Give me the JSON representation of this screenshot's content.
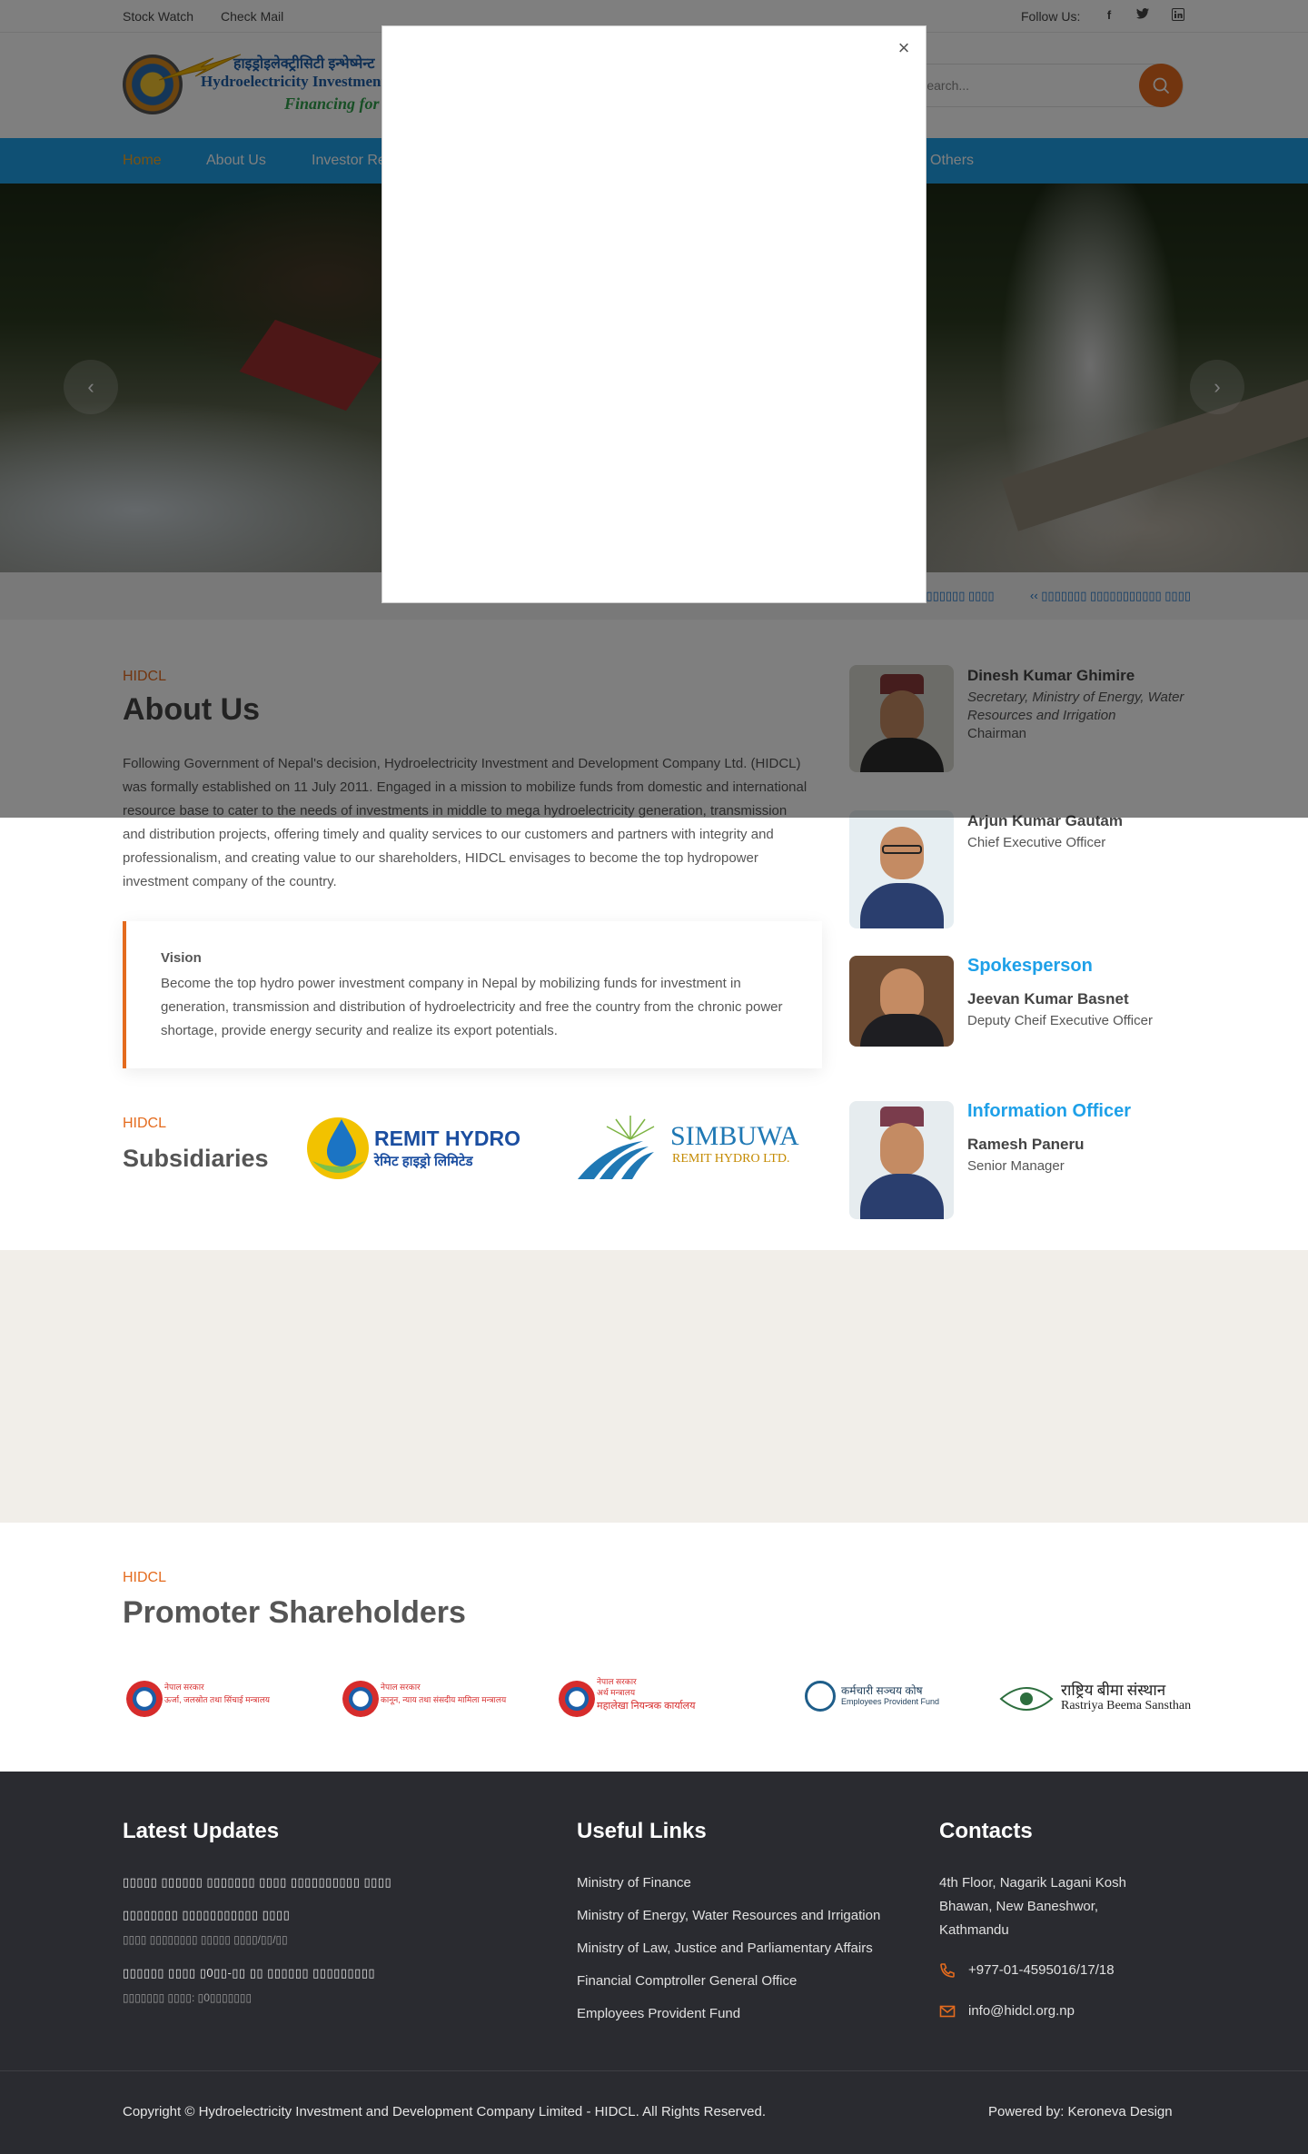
{
  "topbar": {
    "links": [
      "Stock Watch",
      "Check Mail"
    ],
    "follow_label": "Follow Us:",
    "social_icons": [
      "facebook-icon",
      "twitter-icon",
      "linkedin-icon"
    ]
  },
  "header": {
    "logo_line1": "हाइड्रोइलेक्ट्रीसिटी इन्भेष्मेन्ट",
    "logo_line2": "Hydroelectricity Investment",
    "logo_line3": "Financing for",
    "search_placeholder": "Search..."
  },
  "nav": {
    "items": [
      "Home",
      "About Us",
      "Investor Re",
      "Others"
    ],
    "active": "Home"
  },
  "ticker": {
    "items": [
      "‹‹ ▯▯▯▯▯▯▯ ▯▯▯▯",
      "‹‹ ▯▯▯▯▯▯▯ ▯▯▯▯▯▯▯▯▯▯▯ ▯▯▯▯"
    ]
  },
  "about": {
    "eyebrow": "HIDCL",
    "title": "About Us",
    "body": "Following Government of Nepal's decision, Hydroelectricity Investment and Development Company Ltd. (HIDCL) was formally established on 11 July 2011. Engaged in a mission to mobilize funds from domestic and international resource base to cater to the needs of investments in middle to mega hydroelectricity generation, transmission and distribution projects, offering timely and quality services to our customers and partners with integrity and professionalism, and creating value to our shareholders, HIDCL envisages to become the top hydropower investment company of the country.",
    "vision_title": "Vision",
    "vision_body": "Become the top hydro power investment company in Nepal by mobilizing funds for investment in generation, transmission and distribution of hydroelectricity and free the country from the chronic power shortage, provide energy security and realize its export potentials."
  },
  "subsidiaries": {
    "eyebrow": "HIDCL",
    "title": "Subsidiaries",
    "logos": [
      {
        "name": "REMIT HYDRO",
        "sub": "रेमिट हाइड्रो लिमिटेड"
      },
      {
        "name": "SIMBUWA",
        "sub": "REMIT HYDRO LTD."
      }
    ]
  },
  "people": [
    {
      "name": "Dinesh Kumar Ghimire",
      "role": "Secretary, Ministry of Energy, Water Resources and Irrigation",
      "title": "Chairman"
    },
    {
      "name": "Arjun Kumar Gautam",
      "role": "Chief Executive Officer"
    },
    {
      "heading": "Spokesperson",
      "name": "Jeevan Kumar Basnet",
      "role": "Deputy Cheif Executive Officer"
    },
    {
      "heading": "Information Officer",
      "name": "Ramesh Paneru",
      "role": "Senior Manager"
    }
  ],
  "modal": {
    "close_label": "×"
  },
  "promoters": {
    "eyebrow": "HIDCL",
    "title": "Promoter Shareholders",
    "logos": [
      {
        "t1": "नेपाल सरकार",
        "t2": "ऊर्जा, जलस्रोत तथा सिंचाई मन्त्रालय"
      },
      {
        "t1": "नेपाल सरकार",
        "t2": "कानून, न्याय तथा संसदीय मामिला मन्त्रालय"
      },
      {
        "t1": "नेपाल सरकार",
        "t2": "अर्थ मन्त्रालय",
        "t3": "महालेखा नियन्त्रक कार्यालय"
      },
      {
        "t1": "कर्मचारी सञ्चय कोष",
        "t2": "Employees Provident Fund"
      },
      {
        "t1": "राष्ट्रिय बीमा संस्थान",
        "t2": "Rastriya Beema Sansthan"
      }
    ]
  },
  "footer": {
    "updates_title": "Latest Updates",
    "updates": [
      {
        "text": "▯▯▯▯▯ ▯▯▯▯▯▯ ▯▯▯▯▯▯▯ ▯▯▯▯ ▯▯▯▯▯▯▯▯▯▯ ▯▯▯▯",
        "date": ""
      },
      {
        "text": "▯▯▯▯▯▯▯▯ ▯▯▯▯▯▯▯▯▯▯▯ ▯▯▯▯",
        "date": "▯▯▯▯ ▯▯▯▯▯▯▯▯ ▯▯▯▯▯ ▯▯▯▯/▯▯/▯▯"
      },
      {
        "text": "▯▯▯▯▯▯ ▯▯▯▯ ▯0▯▯-▯▯ ▯▯ ▯▯▯▯▯▯ ▯▯▯▯▯▯▯▯▯",
        "date": "▯▯▯▯▯▯▯ ▯▯▯▯: ▯0▯▯▯▯▯▯▯"
      }
    ],
    "links_title": "Useful Links",
    "links": [
      "Ministry of Finance",
      "Ministry of Energy, Water Resources and Irrigation",
      "Ministry of Law, Justice and Parliamentary Affairs",
      "Financial Comptroller General Office",
      "Employees Provident Fund"
    ],
    "contacts_title": "Contacts",
    "address": [
      "4th Floor, Nagarik Lagani Kosh",
      "Bhawan, New Baneshwor,",
      "Kathmandu"
    ],
    "phone": "+977-01-4595016/17/18",
    "email": "info@hidcl.org.np",
    "copyright": "Copyright © Hydroelectricity Investment and Development Company Limited - HIDCL. All Rights Reserved.",
    "powered": "Powered by: Keroneva Design"
  },
  "colors": {
    "accent": "#e46b1e",
    "nav_bg": "#1ea0e8",
    "footer_bg": "#2a2b30",
    "band_bg": "#f1eee9"
  }
}
